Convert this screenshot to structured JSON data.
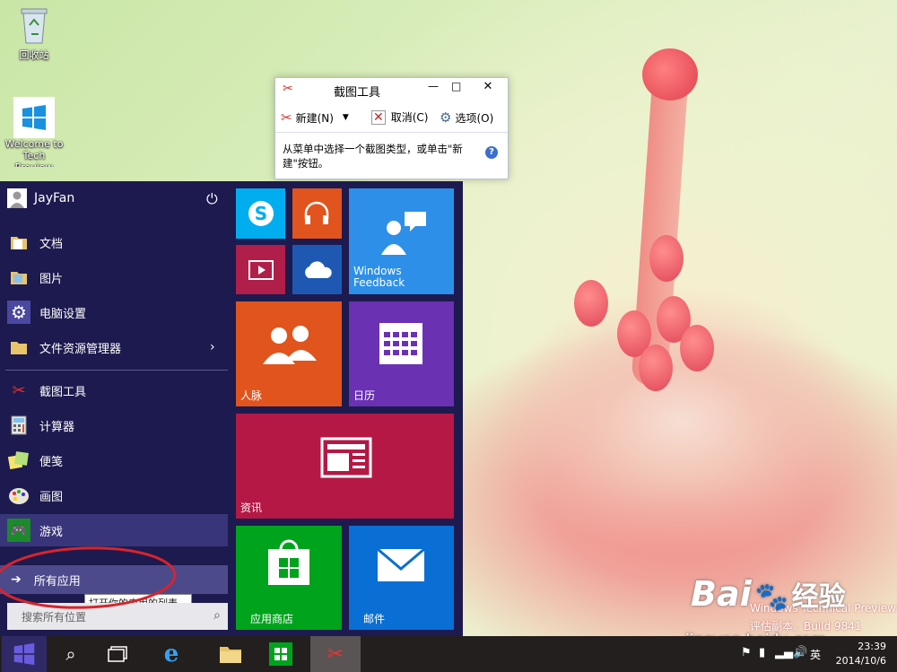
{
  "desktop": {
    "recycle_bin": "回收站",
    "welcome_label_1": "Welcome to",
    "welcome_label_2": "Tech",
    "welcome_label_3": "Preview",
    "watermark_line1": "Windows Technical Preview",
    "watermark_line2": "评估副本。Build 9841",
    "baidu_text": "Bai",
    "baidu_jy": "经验",
    "baidu_url": "jingyan.baidu.com"
  },
  "snipping_tool": {
    "title": "截图工具",
    "new_label": "新建(N)",
    "cancel_label": "取消(C)",
    "options_label": "选项(O)",
    "message": "从菜单中选择一个截图类型，或单击\"新建\"按钮。",
    "help": "?"
  },
  "start_menu": {
    "user_name": "JayFan",
    "places": [
      {
        "label": "文档",
        "icon": "folder-icon"
      },
      {
        "label": "图片",
        "icon": "folder-icon"
      },
      {
        "label": "电脑设置",
        "icon": "gear-icon"
      },
      {
        "label": "文件资源管理器",
        "icon": "folder-icon"
      }
    ],
    "apps": [
      {
        "label": "截图工具",
        "icon": "scissors-icon"
      },
      {
        "label": "计算器",
        "icon": "calculator-icon"
      },
      {
        "label": "便笺",
        "icon": "sticky-note-icon"
      },
      {
        "label": "画图",
        "icon": "palette-icon"
      },
      {
        "label": "游戏",
        "icon": "gamepad-icon"
      }
    ],
    "all_apps": "所有应用",
    "tooltip": "打开你的应用的列表。",
    "search_placeholder": "搜索所有位置"
  },
  "tiles": {
    "windows_feedback": "Windows Feedback",
    "people": "人脉",
    "calendar": "日历",
    "news": "资讯",
    "store": "应用商店",
    "mail": "邮件"
  },
  "taskbar": {
    "time": "23:39",
    "date": "2014/10/6",
    "ime": "英"
  },
  "colors": {
    "start_bg": "#1d1a4f",
    "skype": "#00aef0",
    "music": "#e1541d",
    "video": "#b01e4a",
    "onedrive": "#1f58b3",
    "feedback": "#2d8fe8",
    "people": "#e1541d",
    "calendar": "#6a31b3",
    "news": "#b51845",
    "store": "#00a31c",
    "mail": "#0a6fd4"
  }
}
